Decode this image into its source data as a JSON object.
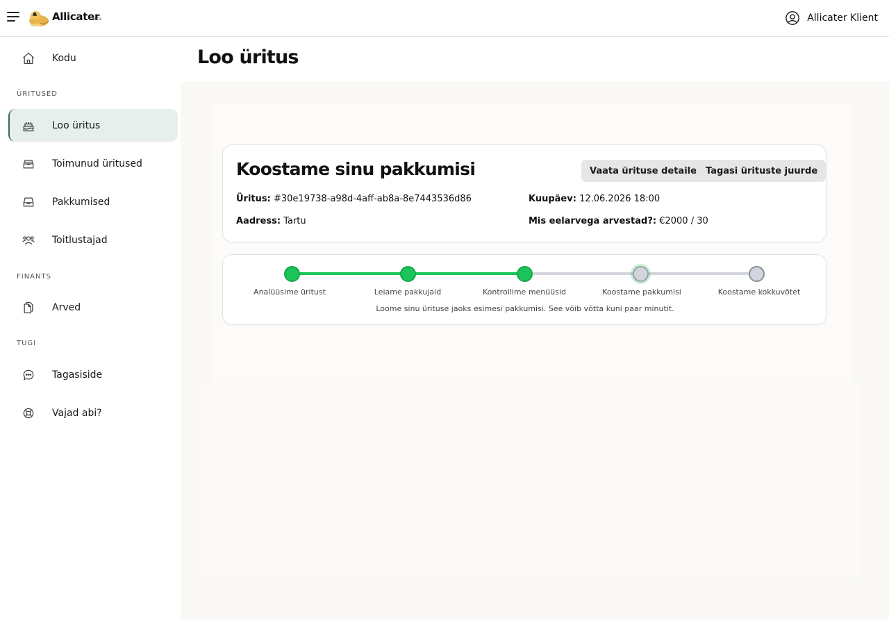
{
  "app": {
    "brand": "Allicater",
    "beta": "beta",
    "user_name": "Allicater Klient"
  },
  "sidebar": {
    "home": "Kodu",
    "sections": {
      "events": "ÜRITUSED",
      "finance": "FINANTS",
      "support": "TUGI"
    },
    "items": [
      {
        "label": "Loo üritus",
        "icon": "cake-icon",
        "active": true
      },
      {
        "label": "Toimunud üritused",
        "icon": "inbox-stack-icon"
      },
      {
        "label": "Pakkumised",
        "icon": "inbox-icon"
      },
      {
        "label": "Toitlustajad",
        "icon": "users-icon"
      },
      {
        "label": "Arved",
        "icon": "documents-icon"
      },
      {
        "label": "Tagasiside",
        "icon": "chat-icon"
      },
      {
        "label": "Vajad abi?",
        "icon": "lifebuoy-icon"
      }
    ]
  },
  "page": {
    "title": "Loo üritus"
  },
  "event": {
    "heading": "Koostame sinu pakkumisi",
    "btn_details": "Vaata ürituse detaile",
    "btn_back": "Tagasi ürituste juurde",
    "event_label": "Üritus:",
    "event_value": "#30e19738-a98d-4aff-ab8a-8e7443536d86",
    "date_label": "Kuupäev:",
    "date_value": "12.06.2026 18:00",
    "address_label": "Aadress:",
    "address_value": "Tartu",
    "budget_label": "Mis eelarvega arvestad?:",
    "budget_value": "€2000 / 30"
  },
  "progress": {
    "steps": [
      {
        "label": "Analüüsime üritust",
        "state": "done"
      },
      {
        "label": "Leiame pakkujaid",
        "state": "done"
      },
      {
        "label": "Kontrollime menüüsid",
        "state": "done"
      },
      {
        "label": "Koostame pakkumisi",
        "state": "current"
      },
      {
        "label": "Koostame kokkuvõtet",
        "state": "todo"
      }
    ],
    "message": "Loome sinu ürituse jaoks esimesi pakkumisi. See võib võtta kuni paar minutit.",
    "colors": {
      "done": "#1dc45a",
      "pending": "#d2d6dc"
    }
  }
}
